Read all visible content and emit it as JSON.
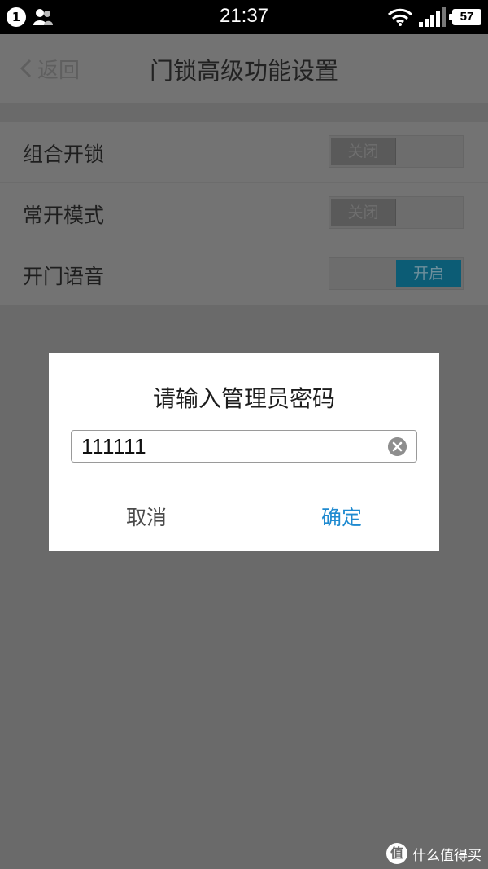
{
  "status_bar": {
    "notification_count": "1",
    "time": "21:37",
    "battery": "57",
    "icons": [
      "person-icon",
      "wifi-icon",
      "signal-icon",
      "battery-icon"
    ]
  },
  "navbar": {
    "back_label": "返回",
    "title": "门锁高级功能设置"
  },
  "settings": [
    {
      "label": "组合开锁",
      "toggle_text": "关闭",
      "on": false
    },
    {
      "label": "常开模式",
      "toggle_text": "关闭",
      "on": false
    },
    {
      "label": "开门语音",
      "toggle_text": "开启",
      "on": true
    }
  ],
  "dialog": {
    "title": "请输入管理员密码",
    "input_value": "111111",
    "cancel_label": "取消",
    "confirm_label": "确定",
    "confirm_color": "#1f8ad0"
  },
  "watermark": {
    "logo_text": "值",
    "text": "什么值得买"
  }
}
